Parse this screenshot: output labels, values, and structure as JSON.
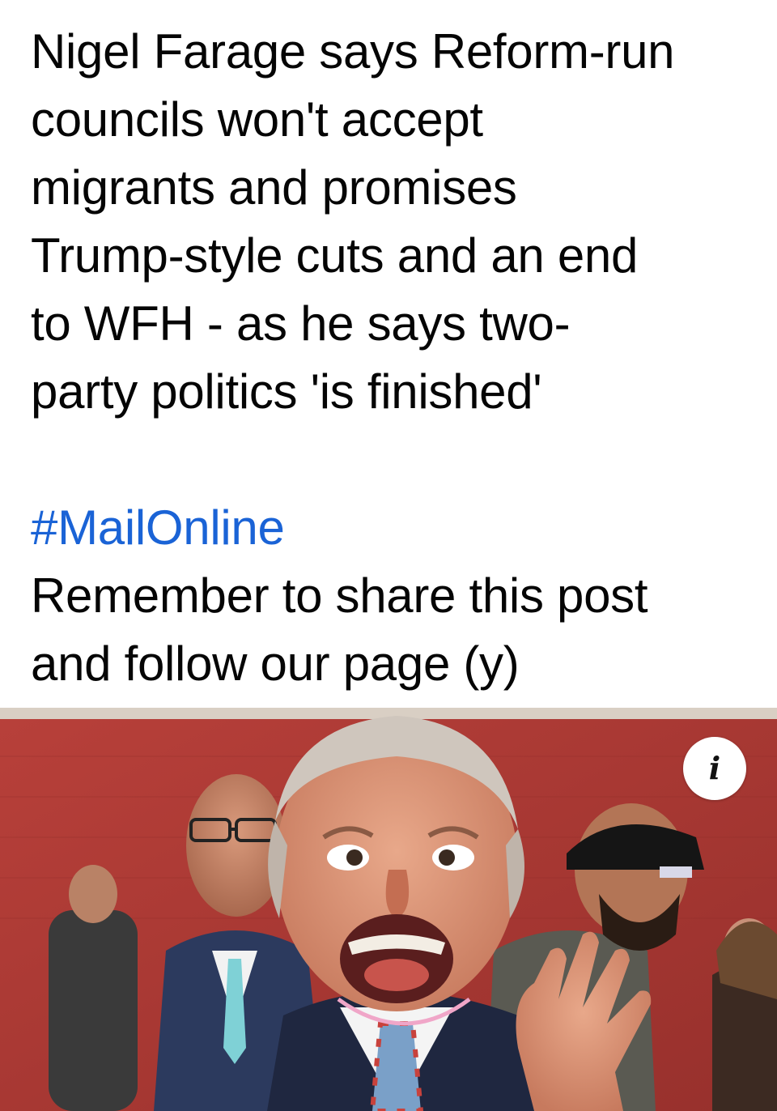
{
  "post": {
    "headline_lines": [
      "Nigel Farage says Reform-run",
      "councils won't accept",
      "migrants and promises",
      "Trump-style cuts and an end",
      "to WFH - as he says two-",
      "party politics 'is finished'"
    ],
    "hashtag": "#MailOnline",
    "cta_lines": [
      "Remember to share this post",
      "and follow our page (y)"
    ]
  },
  "photo": {
    "info_icon": "info-icon",
    "info_glyph": "i"
  },
  "colors": {
    "text": "#050505",
    "hashtag": "#1a63d6",
    "photo_wall": "#a8322e"
  }
}
